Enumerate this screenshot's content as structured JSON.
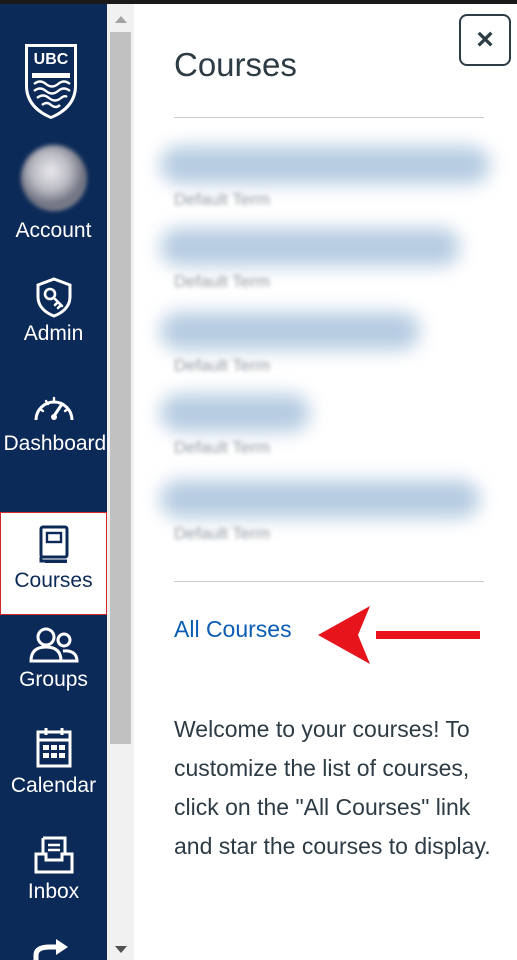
{
  "nav": {
    "logo_text": "UBC",
    "items": [
      {
        "label": "Account",
        "icon": "avatar"
      },
      {
        "label": "Admin",
        "icon": "shield-key-icon"
      },
      {
        "label": "Dashboard",
        "icon": "dashboard-gauge-icon"
      },
      {
        "label": "Courses",
        "icon": "book-icon",
        "active": true
      },
      {
        "label": "Groups",
        "icon": "groups-icon"
      },
      {
        "label": "Calendar",
        "icon": "calendar-icon"
      },
      {
        "label": "Inbox",
        "icon": "inbox-icon"
      }
    ]
  },
  "tray": {
    "title": "Courses",
    "close_label": "×",
    "courses": [
      {
        "term": "Default Term"
      },
      {
        "term": "Default Term"
      },
      {
        "term": "Default Term"
      },
      {
        "term": "Default Term"
      },
      {
        "term": "Default Term"
      }
    ],
    "all_courses_link": "All Courses",
    "welcome_text": "Welcome to your courses! To customize the list of courses, click on the \"All Courses\" link and star the courses to display."
  },
  "colors": {
    "nav_background": "#0c2a58",
    "link": "#0b5db3",
    "annotation_arrow": "#e8141c",
    "active_border": "#d62828"
  }
}
